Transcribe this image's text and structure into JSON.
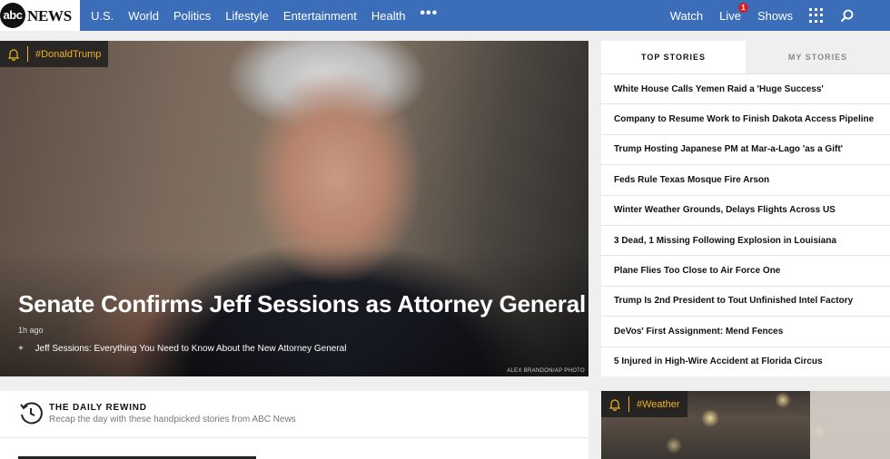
{
  "nav": {
    "logo_badge": "abc",
    "logo_word": "NEWS",
    "items": [
      "U.S.",
      "World",
      "Politics",
      "Lifestyle",
      "Entertainment",
      "Health"
    ],
    "more": "•••",
    "watch": "Watch",
    "live": "Live",
    "live_count": "1",
    "shows": "Shows"
  },
  "hero": {
    "tag": "#DonaldTrump",
    "headline": "Senate Confirms Jeff Sessions as Attorney General",
    "time": "1h ago",
    "related": "Jeff Sessions: Everything You Need to Know About the New Attorney General",
    "credit": "ALEX BRANDON/AP PHOTO"
  },
  "stories": {
    "tabs": [
      "TOP STORIES",
      "MY STORIES"
    ],
    "items": [
      "White House Calls Yemen Raid a 'Huge Success'",
      "Company to Resume Work to Finish Dakota Access Pipeline",
      "Trump Hosting Japanese PM at Mar-a-Lago 'as a Gift'",
      "Feds Rule Texas Mosque Fire Arson",
      "Winter Weather Grounds, Delays Flights Across US",
      "3 Dead, 1 Missing Following Explosion in Louisiana",
      "Plane Flies Too Close to Air Force One",
      "Trump Is 2nd President to Tout Unfinished Intel Factory",
      "DeVos' First Assignment: Mend Fences",
      "5 Injured in High-Wire Accident at Florida Circus"
    ]
  },
  "rewind": {
    "title": "THE DAILY REWIND",
    "subtitle": "Recap the day with these handpicked stories from ABC News"
  },
  "weather": {
    "tag": "#Weather"
  },
  "colors": {
    "nav_blue": "#3b6db8",
    "tag_yellow": "#f2b21b",
    "badge_red": "#d91f26"
  }
}
